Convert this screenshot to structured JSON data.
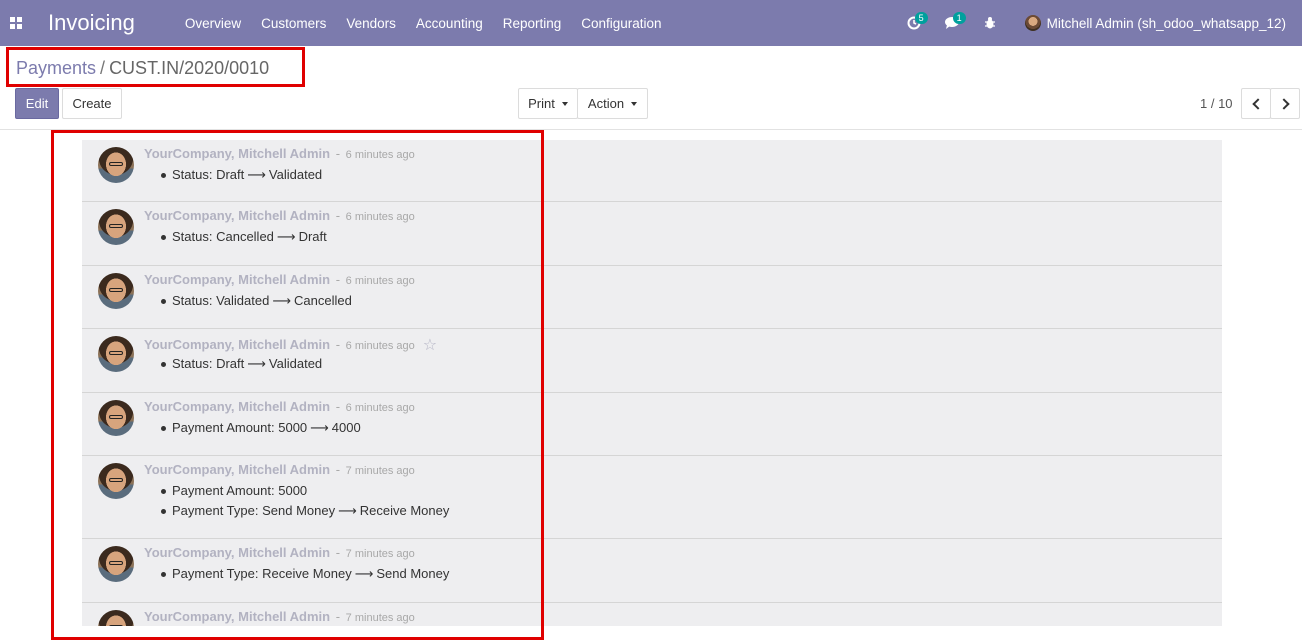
{
  "navbar": {
    "app_title": "Invoicing",
    "menu": [
      "Overview",
      "Customers",
      "Vendors",
      "Accounting",
      "Reporting",
      "Configuration"
    ],
    "activity_badge": "5",
    "messages_badge": "1",
    "user_name": "Mitchell Admin (sh_odoo_whatsapp_12)",
    "colors": {
      "navbar_bg": "#7c7bad",
      "badge_bg": "#00a09d"
    }
  },
  "breadcrumb": {
    "parent": "Payments",
    "separator": "/",
    "current": "CUST.IN/2020/0010"
  },
  "buttons": {
    "edit": "Edit",
    "create": "Create",
    "print": "Print",
    "action": "Action"
  },
  "pager": {
    "value": "1 / 10"
  },
  "messages": [
    {
      "author": "YourCompany, Mitchell Admin",
      "date": "6 minutes ago",
      "starred_hover": false,
      "changes": [
        {
          "field": "Status",
          "old": "Draft",
          "new": "Validated"
        }
      ]
    },
    {
      "author": "YourCompany, Mitchell Admin",
      "date": "6 minutes ago",
      "starred_hover": false,
      "changes": [
        {
          "field": "Status",
          "old": "Cancelled",
          "new": "Draft"
        }
      ]
    },
    {
      "author": "YourCompany, Mitchell Admin",
      "date": "6 minutes ago",
      "starred_hover": false,
      "changes": [
        {
          "field": "Status",
          "old": "Validated",
          "new": "Cancelled"
        }
      ]
    },
    {
      "author": "YourCompany, Mitchell Admin",
      "date": "6 minutes ago",
      "starred_hover": true,
      "changes": [
        {
          "field": "Status",
          "old": "Draft",
          "new": "Validated"
        }
      ]
    },
    {
      "author": "YourCompany, Mitchell Admin",
      "date": "6 minutes ago",
      "starred_hover": false,
      "changes": [
        {
          "field": "Payment Amount",
          "old": "5000",
          "new": "4000"
        }
      ]
    },
    {
      "author": "YourCompany, Mitchell Admin",
      "date": "7 minutes ago",
      "starred_hover": false,
      "changes": [
        {
          "field": "Payment Amount",
          "old": "5000",
          "new": ""
        },
        {
          "field": "Payment Type",
          "old": "Send Money",
          "new": "Receive Money"
        }
      ]
    },
    {
      "author": "YourCompany, Mitchell Admin",
      "date": "7 minutes ago",
      "starred_hover": false,
      "changes": [
        {
          "field": "Payment Type",
          "old": "Receive Money",
          "new": "Send Money"
        }
      ]
    },
    {
      "author": "YourCompany, Mitchell Admin",
      "date": "7 minutes ago",
      "starred_hover": false,
      "changes": []
    }
  ],
  "icons": {
    "arrow": "⟶",
    "star": "☆"
  }
}
